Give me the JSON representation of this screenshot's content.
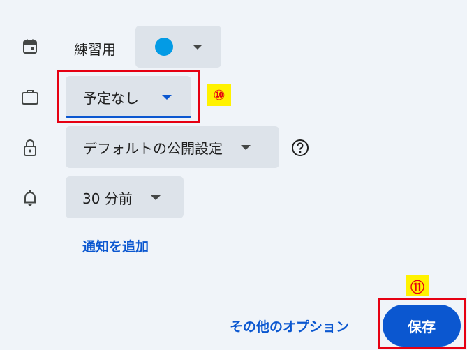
{
  "calendar": {
    "label": "練習用",
    "color": "#039be5",
    "icon": "calendar-icon"
  },
  "availability": {
    "value": "予定なし",
    "icon": "briefcase-icon"
  },
  "visibility": {
    "value": "デフォルトの公開設定",
    "icon": "lock-icon",
    "help_icon": "help-icon"
  },
  "notification": {
    "value": "30 分前",
    "icon": "bell-icon",
    "add_label": "通知を追加"
  },
  "footer": {
    "more_options": "その他のオプション",
    "save": "保存"
  },
  "annotations": {
    "callout_10": "⑩",
    "callout_11": "⑪",
    "highlight_color": "#e60012",
    "callout_bg": "#fff200"
  },
  "colors": {
    "accent": "#0b57d0",
    "background": "#f0f4f9",
    "pill": "#dde3ea"
  }
}
